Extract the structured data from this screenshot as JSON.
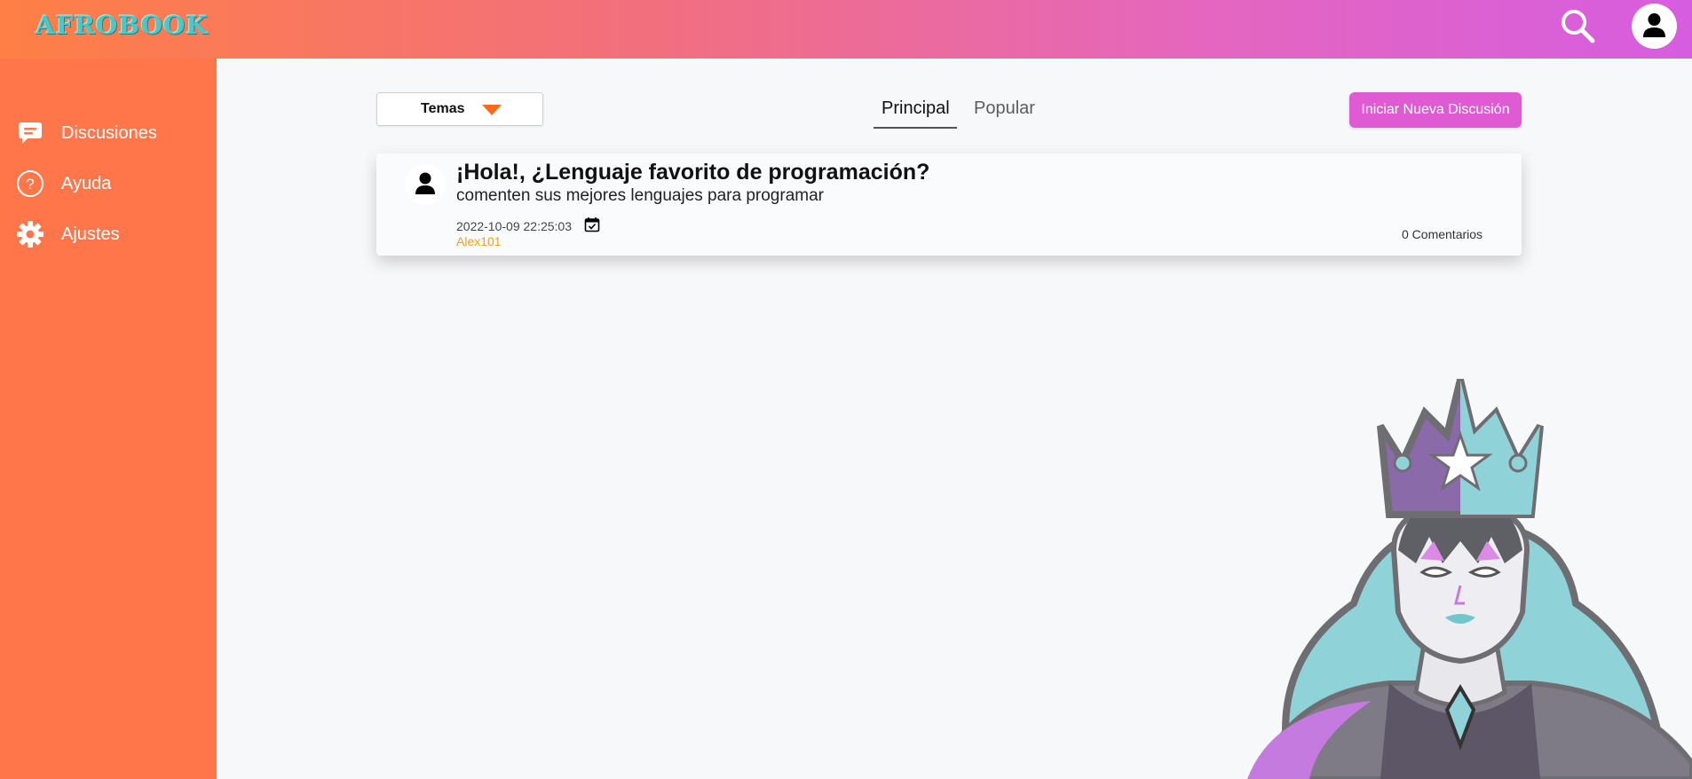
{
  "app": {
    "logo": "AFROBOOK"
  },
  "header": {
    "search_icon": "search-icon",
    "account_icon": "user-icon"
  },
  "sidebar": {
    "items": [
      {
        "label": "Discusiones",
        "icon": "chat-icon"
      },
      {
        "label": "Ayuda",
        "icon": "help-icon"
      },
      {
        "label": "Ajustes",
        "icon": "gear-icon"
      }
    ]
  },
  "toolbar": {
    "topics_label": "Temas",
    "tabs": [
      {
        "label": "Principal",
        "active": true
      },
      {
        "label": "Popular",
        "active": false
      }
    ],
    "new_discussion_label": "Iniciar Nueva Discusión"
  },
  "posts": [
    {
      "title": "¡Hola!, ¿Lenguaje favorito de programación?",
      "subtitle": "comenten sus mejores lenguajes para programar",
      "datetime": "2022-10-09 22:25:03",
      "author": "Alex101",
      "comments": "0 Comentarios"
    }
  ],
  "colors": {
    "sidebar": "#ff764b",
    "accent_button": "#e05ad3",
    "author": "#f2a01c",
    "logo": "#4fc6c4"
  }
}
